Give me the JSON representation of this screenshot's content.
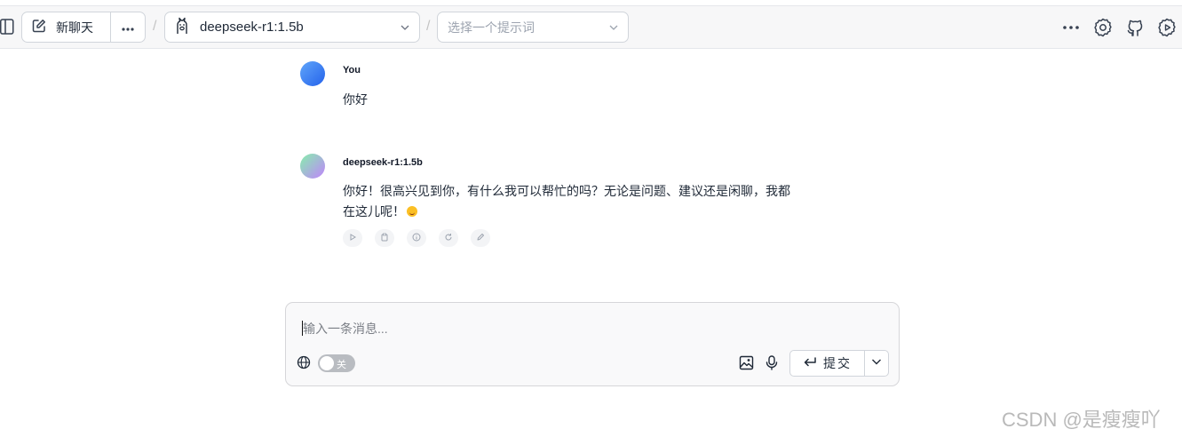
{
  "header": {
    "new_chat_label": "新聊天",
    "separator": "/",
    "model_selected": "deepseek-r1:1.5b",
    "prompt_placeholder": "选择一个提示词"
  },
  "messages": [
    {
      "author": "You",
      "text": "你好"
    },
    {
      "author": "deepseek-r1:1.5b",
      "line1": "你好！很高兴见到你，有什么我可以帮忙的吗？无论是问题、建议还是闲聊，我都",
      "line2": "在这儿呢！"
    }
  ],
  "composer": {
    "placeholder": "输入一条消息...",
    "web_search_toggle_label": "关",
    "submit_label": "提交"
  },
  "watermark": "CSDN @是瘦瘦吖",
  "icons": {
    "sidebar": "sidebar-toggle-icon",
    "edit": "edit-icon",
    "more": "more-horizontal-icon",
    "llama": "llama-icon",
    "chevron": "chevron-down-icon",
    "settings": "gear-icon",
    "github": "github-icon",
    "bot_settings": "bot-settings-icon"
  }
}
